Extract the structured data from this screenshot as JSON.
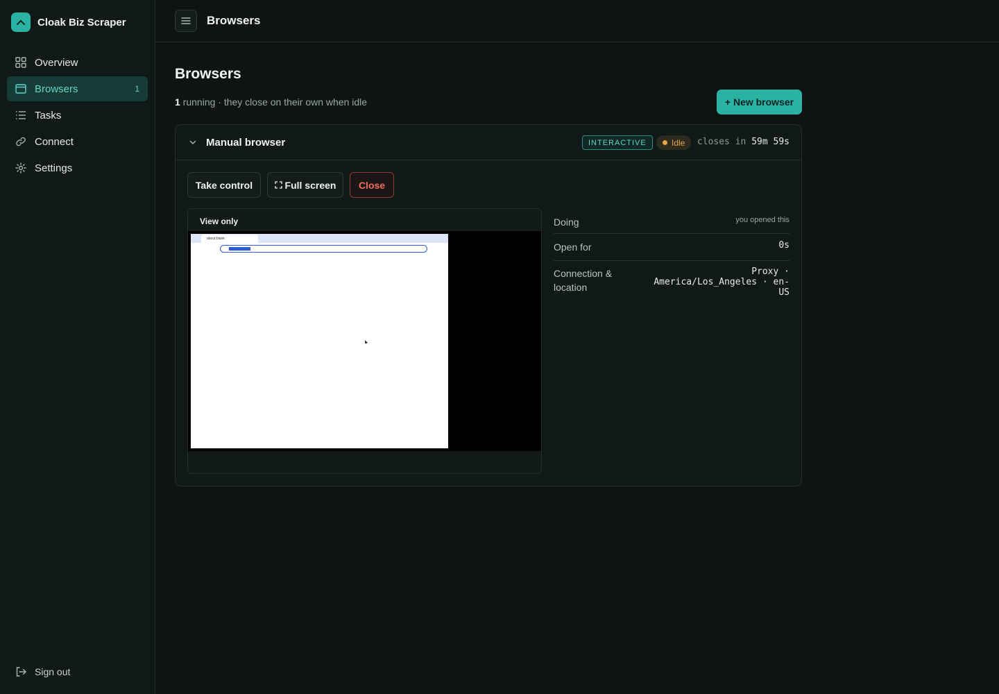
{
  "app": {
    "name": "Cloak Biz Scraper"
  },
  "sidebar": {
    "items": [
      {
        "label": "Overview",
        "icon": "grid-icon"
      },
      {
        "label": "Browsers",
        "icon": "browser-window-icon",
        "badge": "1",
        "active": true
      },
      {
        "label": "Tasks",
        "icon": "list-icon"
      },
      {
        "label": "Connect",
        "icon": "link-icon"
      },
      {
        "label": "Settings",
        "icon": "gear-icon"
      }
    ],
    "signout": "Sign out"
  },
  "topbar": {
    "title": "Browsers"
  },
  "page": {
    "title": "Browsers",
    "running_count": "1",
    "subtitle_rest": " running · they close on their own when idle",
    "new_button": "+ New browser"
  },
  "browser_card": {
    "name": "Manual browser",
    "mode_tag": "INTERACTIVE",
    "status": "Idle",
    "closes_prefix": "closes in",
    "closes_value": "59m 59s",
    "actions": {
      "take_control": "Take control",
      "full_screen": "Full screen",
      "close": "Close"
    },
    "viewer_label": "View only",
    "screenshot": {
      "tab_title": "about:blank",
      "url": "about:blank"
    },
    "details": [
      {
        "label": "Doing",
        "value": "you opened this"
      },
      {
        "label": "Open for",
        "value": "0s"
      },
      {
        "label": "Connection & location",
        "value": "Proxy · America/Los_Angeles · en-US"
      }
    ]
  },
  "colors": {
    "accent": "#2ab3a3",
    "background": "#0e1414",
    "idle": "#e2a642",
    "danger": "#ef6e5b"
  }
}
